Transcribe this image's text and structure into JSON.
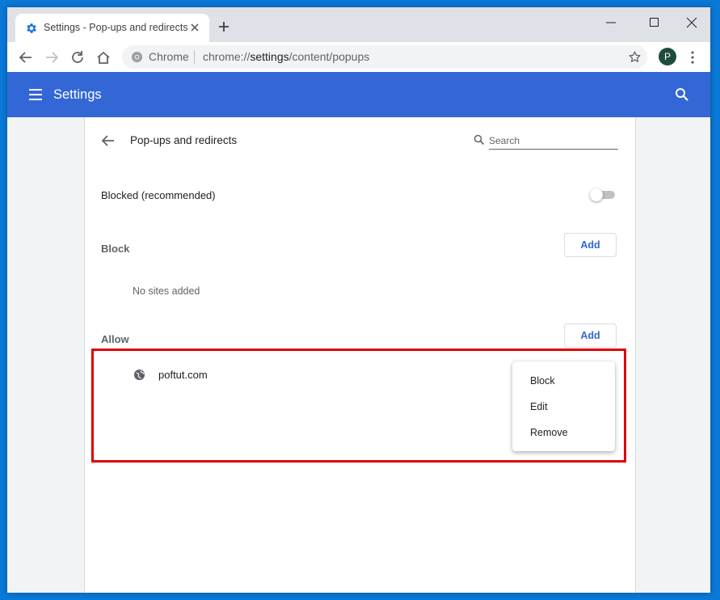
{
  "tab": {
    "title": "Settings - Pop-ups and redirects"
  },
  "omnibox": {
    "chip": "Chrome",
    "url_scheme": "chrome://",
    "url_host": "settings",
    "url_path": "/content/popups"
  },
  "profile": {
    "initial": "P"
  },
  "header": {
    "title": "Settings"
  },
  "page": {
    "title": "Pop-ups and redirects",
    "search_placeholder": "Search"
  },
  "toggle_row": {
    "label": "Blocked (recommended)",
    "enabled": false
  },
  "block": {
    "label": "Block",
    "add_label": "Add",
    "empty": "No sites added"
  },
  "allow": {
    "label": "Allow",
    "add_label": "Add",
    "sites": [
      "poftut.com"
    ]
  },
  "context_menu": {
    "items": [
      "Block",
      "Edit",
      "Remove"
    ]
  },
  "colors": {
    "header": "#3367d6",
    "desktop": "#0a78d7",
    "highlight": "#e00000",
    "avatar": "#1e4d3c"
  },
  "icons": [
    "settings-gear-icon",
    "close-icon",
    "plus-icon",
    "minimize-icon",
    "maximize-icon",
    "back-icon",
    "forward-icon",
    "reload-icon",
    "home-icon",
    "chrome-logo-icon",
    "star-icon",
    "more-vert-icon",
    "hamburger-icon",
    "search-icon",
    "arrow-back-icon",
    "globe-icon"
  ]
}
